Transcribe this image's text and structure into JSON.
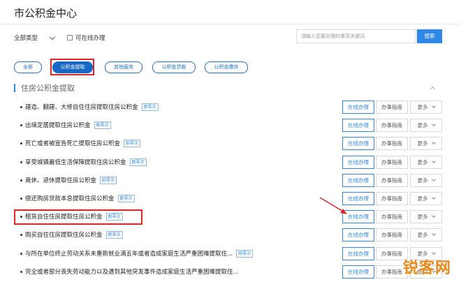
{
  "header": {
    "title": "市公积金中心"
  },
  "filter": {
    "type_label": "全部类型",
    "online_label": "可在线办理"
  },
  "search": {
    "placeholder": "请输入您要办理的事项关键词",
    "button": "搜索"
  },
  "tabs": [
    {
      "label": "全部"
    },
    {
      "label": "公积金提取"
    },
    {
      "label": "其他服务"
    },
    {
      "label": "公积金贷款"
    },
    {
      "label": "公积金缴存"
    }
  ],
  "section": {
    "title": "住房公积金提取"
  },
  "actions": {
    "online": "在线办理",
    "guide": "办事指南",
    "more": "更多"
  },
  "badge_text": "跑零次",
  "rows": [
    {
      "label": "建造、翻建、大修自住住房提取住房公积金"
    },
    {
      "label": "出境定居提取住房公积金"
    },
    {
      "label": "死亡或者被宣告死亡提取住房公积金"
    },
    {
      "label": "享受城镇最低生活保障提取住房公积金"
    },
    {
      "label": "离休、退休提取住房公积金"
    },
    {
      "label": "偿还购房贷款本息提取住房公积金"
    },
    {
      "label": "租赁自住住房提取住房公积金"
    },
    {
      "label": "购买自住住房提取住房公积金"
    },
    {
      "label": "与所在单位终止劳动关系未重新就业满五年或者造成家庭生活严重困难提取住..."
    },
    {
      "label": "完全或者部分丧失劳动能力以及遇到其他突发事件造成家庭生活严重困难提取住..."
    }
  ],
  "watermark": "锐客网",
  "colors": {
    "accent": "#2f88e8",
    "tab_active": "#1868c8",
    "highlight": "#e0242a",
    "watermark": "#e8891a"
  }
}
